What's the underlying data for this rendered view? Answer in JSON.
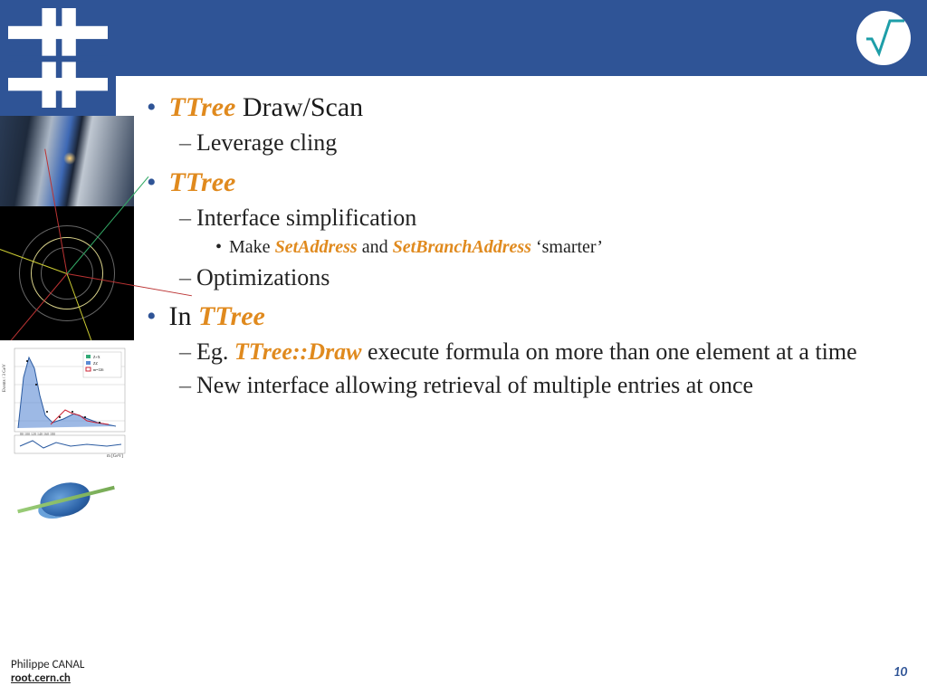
{
  "bullets": {
    "b1": {
      "orange": "TTree",
      "rest": " Draw/Scan",
      "sub1": "Leverage cling"
    },
    "b2": {
      "orange": "TTree",
      "sub1": "Interface simplification",
      "subsub_pre": "Make ",
      "subsub_o1": "SetAddress",
      "subsub_mid": " and ",
      "subsub_o2": "SetBranchAddress",
      "subsub_post": " ‘smarter’",
      "sub2": "Optimizations"
    },
    "b3": {
      "pre": "In ",
      "orange": "TTree",
      "sub1_pre": "Eg.  ",
      "sub1_o": "TTree::Draw",
      "sub1_post": " execute formula on more than one element at a time",
      "sub2": "New interface allowing retrieval of multiple entries at once"
    }
  },
  "footer": {
    "author": "Philippe  CANAL",
    "site": "root.cern.ch"
  },
  "page": "10",
  "colors": {
    "brand": "#2f5496",
    "accent": "#e08a1e"
  }
}
